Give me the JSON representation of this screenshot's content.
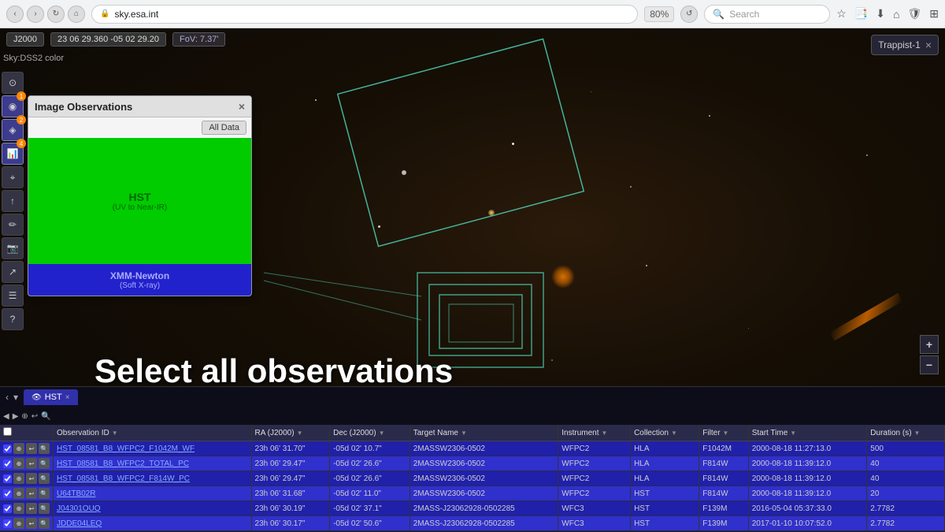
{
  "browser": {
    "url": "sky.esa.int",
    "zoom": "80%",
    "search_placeholder": "Search"
  },
  "topbar": {
    "epoch": "J2000",
    "coords": "23 06 29.360 -05 02 29.20",
    "fov": "FoV: 7.37'",
    "sky_mode": "Sky:DSS2 color"
  },
  "trappist_box": {
    "label": "Trappist-1",
    "close": "×"
  },
  "img_obs_panel": {
    "title": "Image Observations",
    "close": "×",
    "all_data_btn": "All Data",
    "hst_label": "HST",
    "hst_sublabel": "(UV to Near-IR)",
    "xmm_label": "XMM-Newton",
    "xmm_sublabel": "(Soft X-ray)"
  },
  "select_all_text": "Select all observations",
  "hst_tab": {
    "label": "HST",
    "close": "×"
  },
  "table": {
    "columns": [
      "Observation ID",
      "RA (J2000)",
      "Dec (J2000)",
      "Target Name",
      "Instrument",
      "Collection",
      "Filter",
      "Start Time",
      "Duration (s)"
    ],
    "rows": [
      {
        "id": "HST_08581_B8_WFPC2_F1042M_WF",
        "ra": "23h 06' 31.70\"",
        "dec": "-05d 02' 10.7\"",
        "target": "2MASSW2306-0502",
        "instrument": "WFPC2",
        "collection": "HLA",
        "filter": "F1042M",
        "start": "2000-08-18 11:27:13.0",
        "duration": "500"
      },
      {
        "id": "HST_08581_B8_WFPC2_TOTAL_PC",
        "ra": "23h 06' 29.47\"",
        "dec": "-05d 02' 26.6\"",
        "target": "2MASSW2306-0502",
        "instrument": "WFPC2",
        "collection": "HLA",
        "filter": "F814W",
        "start": "2000-08-18 11:39:12.0",
        "duration": "40"
      },
      {
        "id": "HST_08581_B8_WFPC2_F814W_PC",
        "ra": "23h 06' 29.47\"",
        "dec": "-05d 02' 26.6\"",
        "target": "2MASSW2306-0502",
        "instrument": "WFPC2",
        "collection": "HLA",
        "filter": "F814W",
        "start": "2000-08-18 11:39:12.0",
        "duration": "40"
      },
      {
        "id": "U64TB02R",
        "ra": "23h 06' 31.68\"",
        "dec": "-05d 02' 11.0\"",
        "target": "2MASSW2306-0502",
        "instrument": "WFPC2",
        "collection": "HST",
        "filter": "F814W",
        "start": "2000-08-18 11:39:12.0",
        "duration": "20"
      },
      {
        "id": "J04301OUQ",
        "ra": "23h 06' 30.19\"",
        "dec": "-05d 02' 37.1\"",
        "target": "2MASS-J23062928-0502285",
        "instrument": "WFC3",
        "collection": "HST",
        "filter": "F139M",
        "start": "2016-05-04 05:37:33.0",
        "duration": "2.7782"
      },
      {
        "id": "JDDE04LEQ",
        "ra": "23h 06' 30.17\"",
        "dec": "-05d 02' 50.6\"",
        "target": "2MASS-J23062928-0502285",
        "instrument": "WFC3",
        "collection": "HST",
        "filter": "F139M",
        "start": "2017-01-10 10:07:52.0",
        "duration": "2.7782"
      }
    ]
  },
  "sidebar": {
    "items": [
      {
        "icon": "⊙",
        "label": "sky"
      },
      {
        "icon": "◉",
        "label": "layers",
        "badge": "1"
      },
      {
        "icon": "◈",
        "label": "catalog",
        "badge": "2"
      },
      {
        "icon": "📊",
        "label": "charts",
        "badge": "4"
      },
      {
        "icon": "⌖",
        "label": "pointer"
      },
      {
        "icon": "↑",
        "label": "upload"
      },
      {
        "icon": "✏",
        "label": "draw"
      },
      {
        "icon": "📷",
        "label": "capture"
      },
      {
        "icon": "↗",
        "label": "share"
      },
      {
        "icon": "☰",
        "label": "menu"
      },
      {
        "icon": "?",
        "label": "help"
      }
    ]
  },
  "zoom_controls": {
    "plus": "+",
    "minus": "−"
  }
}
